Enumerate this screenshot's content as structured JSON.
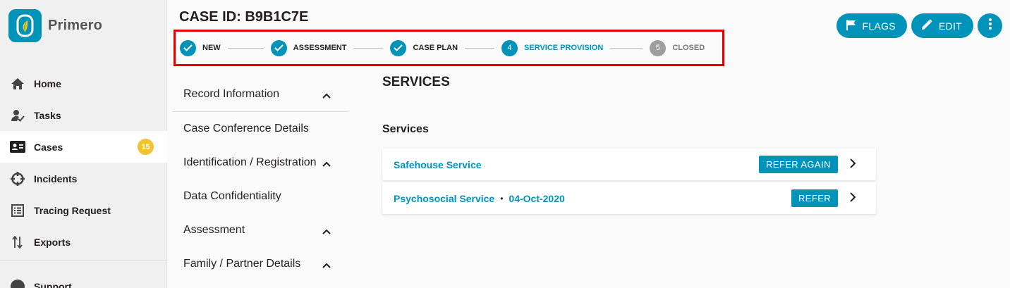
{
  "app": {
    "name": "Primero"
  },
  "colors": {
    "accent": "#0093ba",
    "badge": "#f2c230",
    "highlight": "#e30000"
  },
  "nav": {
    "items": [
      {
        "label": "Home",
        "icon": "home-icon"
      },
      {
        "label": "Tasks",
        "icon": "tasks-icon"
      },
      {
        "label": "Cases",
        "icon": "cases-icon",
        "badge": "15",
        "active": true
      },
      {
        "label": "Incidents",
        "icon": "incidents-icon"
      },
      {
        "label": "Tracing Request",
        "icon": "tracing-request-icon"
      },
      {
        "label": "Exports",
        "icon": "exports-icon"
      }
    ],
    "support": "Support"
  },
  "header": {
    "case_id": "CASE ID: B9B1C7E",
    "flags_label": "FLAGS",
    "edit_label": "EDIT"
  },
  "workflow": {
    "steps": [
      {
        "number": "1",
        "label": "NEW",
        "state": "done"
      },
      {
        "number": "2",
        "label": "ASSESSMENT",
        "state": "done"
      },
      {
        "number": "3",
        "label": "CASE PLAN",
        "state": "done"
      },
      {
        "number": "4",
        "label": "SERVICE PROVISION",
        "state": "current"
      },
      {
        "number": "5",
        "label": "CLOSED",
        "state": "pending"
      }
    ]
  },
  "form_sections": [
    {
      "label": "Record Information",
      "expandable": true
    },
    {
      "label": "Case Conference Details",
      "expandable": false
    },
    {
      "label": "Identification / Registration",
      "expandable": true
    },
    {
      "label": "Data Confidentiality",
      "expandable": false
    },
    {
      "label": "Assessment",
      "expandable": true
    },
    {
      "label": "Family / Partner Details",
      "expandable": true
    }
  ],
  "main": {
    "title": "SERVICES",
    "subtitle": "Services",
    "services": [
      {
        "name": "Safehouse Service",
        "date": "",
        "action": "REFER AGAIN"
      },
      {
        "name": "Psychosocial Service",
        "date": "04-Oct-2020",
        "action": "REFER"
      }
    ]
  }
}
